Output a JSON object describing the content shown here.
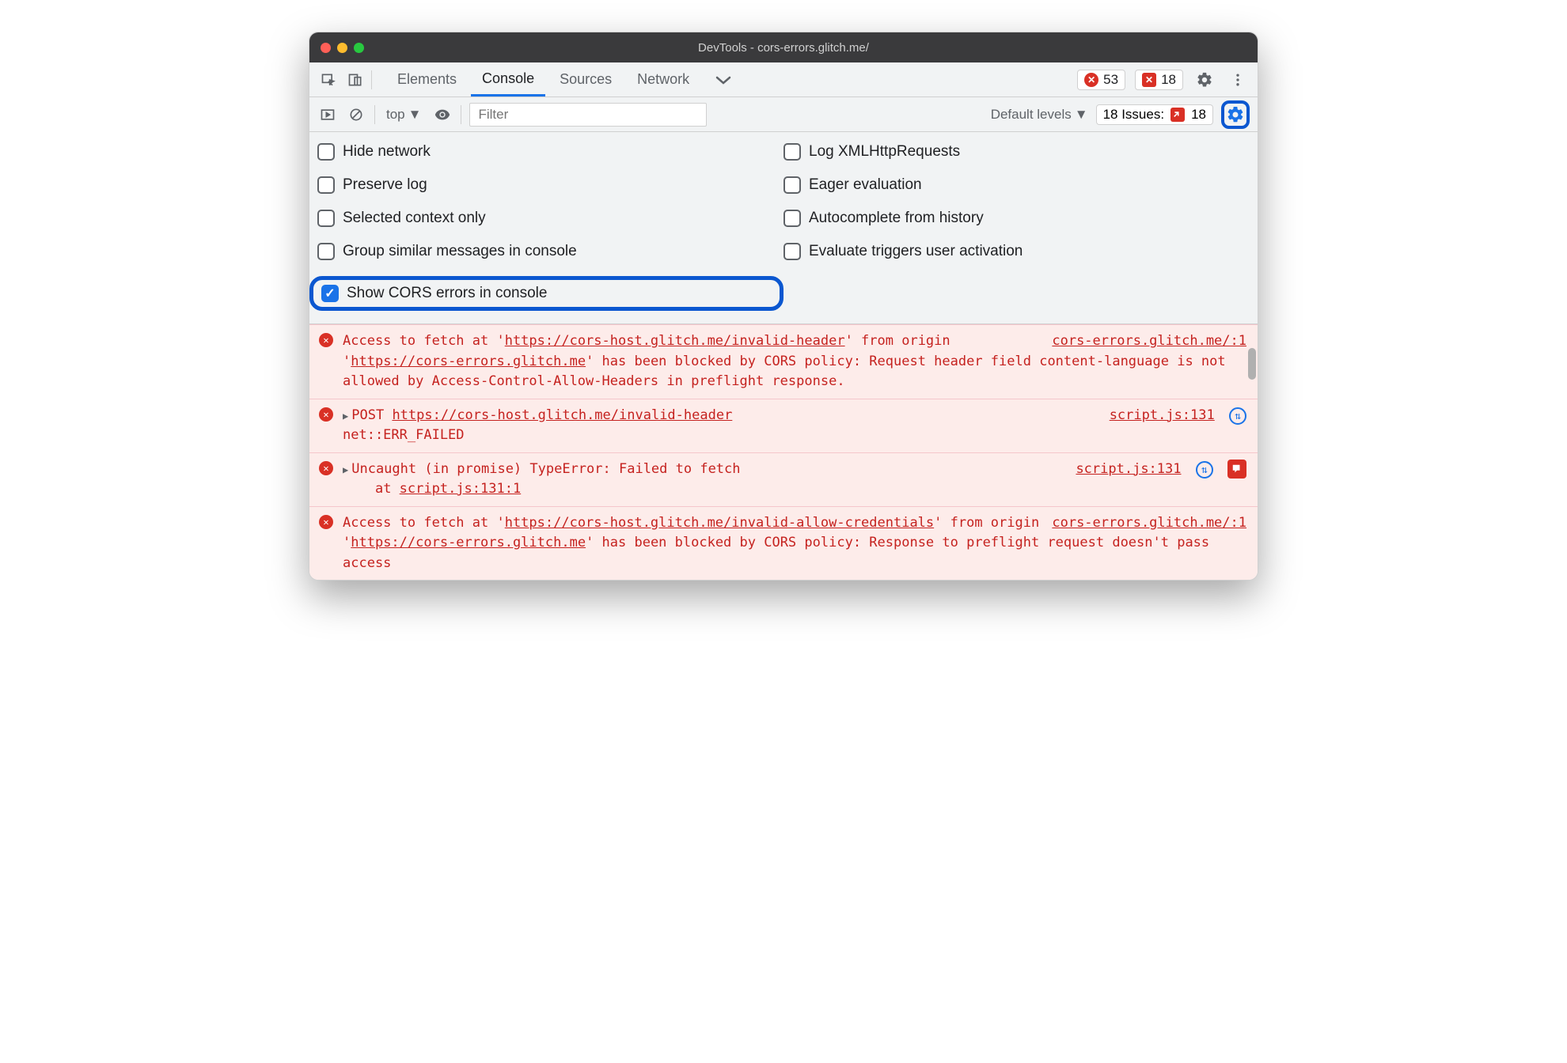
{
  "window": {
    "title": "DevTools - cors-errors.glitch.me/"
  },
  "toolbar": {
    "tabs": [
      "Elements",
      "Console",
      "Sources",
      "Network"
    ],
    "active_tab": 1,
    "error_count": "53",
    "issue_count_badge": "18"
  },
  "subtoolbar": {
    "context": "top",
    "filter_placeholder": "Filter",
    "levels": "Default levels",
    "issues_label": "18 Issues:",
    "issues_count": "18"
  },
  "settings": {
    "left": [
      {
        "label": "Hide network",
        "checked": false
      },
      {
        "label": "Preserve log",
        "checked": false
      },
      {
        "label": "Selected context only",
        "checked": false
      },
      {
        "label": "Group similar messages in console",
        "checked": false
      },
      {
        "label": "Show CORS errors in console",
        "checked": true,
        "highlighted": true
      }
    ],
    "right": [
      {
        "label": "Log XMLHttpRequests",
        "checked": false
      },
      {
        "label": "Eager evaluation",
        "checked": false
      },
      {
        "label": "Autocomplete from history",
        "checked": false
      },
      {
        "label": "Evaluate triggers user activation",
        "checked": false
      }
    ]
  },
  "console": [
    {
      "type": "cors",
      "text_a": "Access to fetch at '",
      "url1": "https://cors-host.glitch.me/invalid-header",
      "text_b": "' from origin '",
      "url2": "https://cors-errors.glitch.me",
      "text_c": "' has been blocked by CORS policy: Request header field content-language is not allowed by Access-Control-Allow-Headers in preflight response.",
      "src": "cors-errors.glitch.me/:1"
    },
    {
      "type": "post",
      "method": "POST",
      "url": "https://cors-host.glitch.me/invalid-header",
      "err": "net::ERR_FAILED",
      "src": "script.js:131"
    },
    {
      "type": "uncaught",
      "line1": "Uncaught (in promise) TypeError: Failed to fetch",
      "at": "at ",
      "loc": "script.js:131:1",
      "src": "script.js:131"
    },
    {
      "type": "cors",
      "text_a": "Access to fetch at '",
      "url1": "https://cors-host.glitch.me/invalid-allow-credentials",
      "text_b": "' from origin '",
      "url2": "https://cors-errors.glitch.me",
      "text_c": "' has been blocked by CORS policy: Response to preflight request doesn't pass access",
      "src": "cors-errors.glitch.me/:1"
    }
  ]
}
